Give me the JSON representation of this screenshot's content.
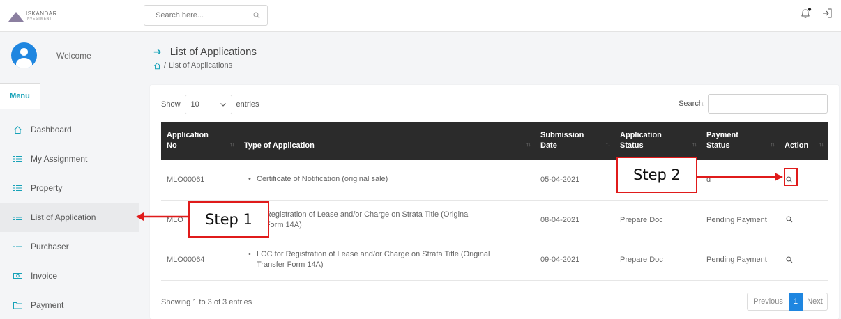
{
  "brand": {
    "line1": "ISKANDAR",
    "line2": "INVESTMENT"
  },
  "search": {
    "placeholder": "Search here..."
  },
  "sidebar": {
    "welcome": "Welcome",
    "menu_tab": "Menu",
    "items": [
      {
        "label": "Dashboard",
        "icon": "home-icon"
      },
      {
        "label": "My Assignment",
        "icon": "list-icon"
      },
      {
        "label": "Property",
        "icon": "list-icon"
      },
      {
        "label": "List of Application",
        "icon": "list-icon",
        "active": true
      },
      {
        "label": "Purchaser",
        "icon": "list-icon"
      },
      {
        "label": "Invoice",
        "icon": "money-icon"
      },
      {
        "label": "Payment",
        "icon": "folder-icon"
      }
    ]
  },
  "page": {
    "title": "List of Applications",
    "breadcrumb": "List of Applications"
  },
  "table_controls": {
    "show_label": "Show",
    "entries_value": "10",
    "entries_label": "entries",
    "search_label": "Search:"
  },
  "table": {
    "headers": [
      {
        "line1": "Application",
        "line2": "No"
      },
      {
        "line1": "",
        "line2": "Type of Application"
      },
      {
        "line1": "Submission",
        "line2": "Date"
      },
      {
        "line1": "Application",
        "line2": "Status"
      },
      {
        "line1": "Payment",
        "line2": "Status"
      },
      {
        "line1": "",
        "line2": "Action"
      }
    ],
    "rows": [
      {
        "app_no": "MLO00061",
        "type_line1": "Certificate of Notification (original sale)",
        "type_line2": "",
        "date": "05-04-2021",
        "app_status": "",
        "pay_status": "d"
      },
      {
        "app_no": "MLO",
        "type_line1": "or Registration of Lease and/or Charge on Strata Title (Original",
        "type_line2": "er Form 14A)",
        "date": "08-04-2021",
        "app_status": "Prepare Doc",
        "pay_status": "Pending Payment"
      },
      {
        "app_no": "MLO00064",
        "type_line1": "LOC for Registration of Lease and/or Charge on Strata Title (Original",
        "type_line2": "Transfer Form 14A)",
        "date": "09-04-2021",
        "app_status": "Prepare Doc",
        "pay_status": "Pending Payment"
      }
    ]
  },
  "footer": {
    "info": "Showing 1 to 3 of 3 entries",
    "prev": "Previous",
    "current": "1",
    "next": "Next"
  },
  "annotations": {
    "step1": "Step 1",
    "step2": "Step 2",
    "color": "#e01b1b"
  },
  "colors": {
    "accent": "#17a2b8",
    "primary": "#1f86e0",
    "table_header": "#2b2b2b"
  }
}
